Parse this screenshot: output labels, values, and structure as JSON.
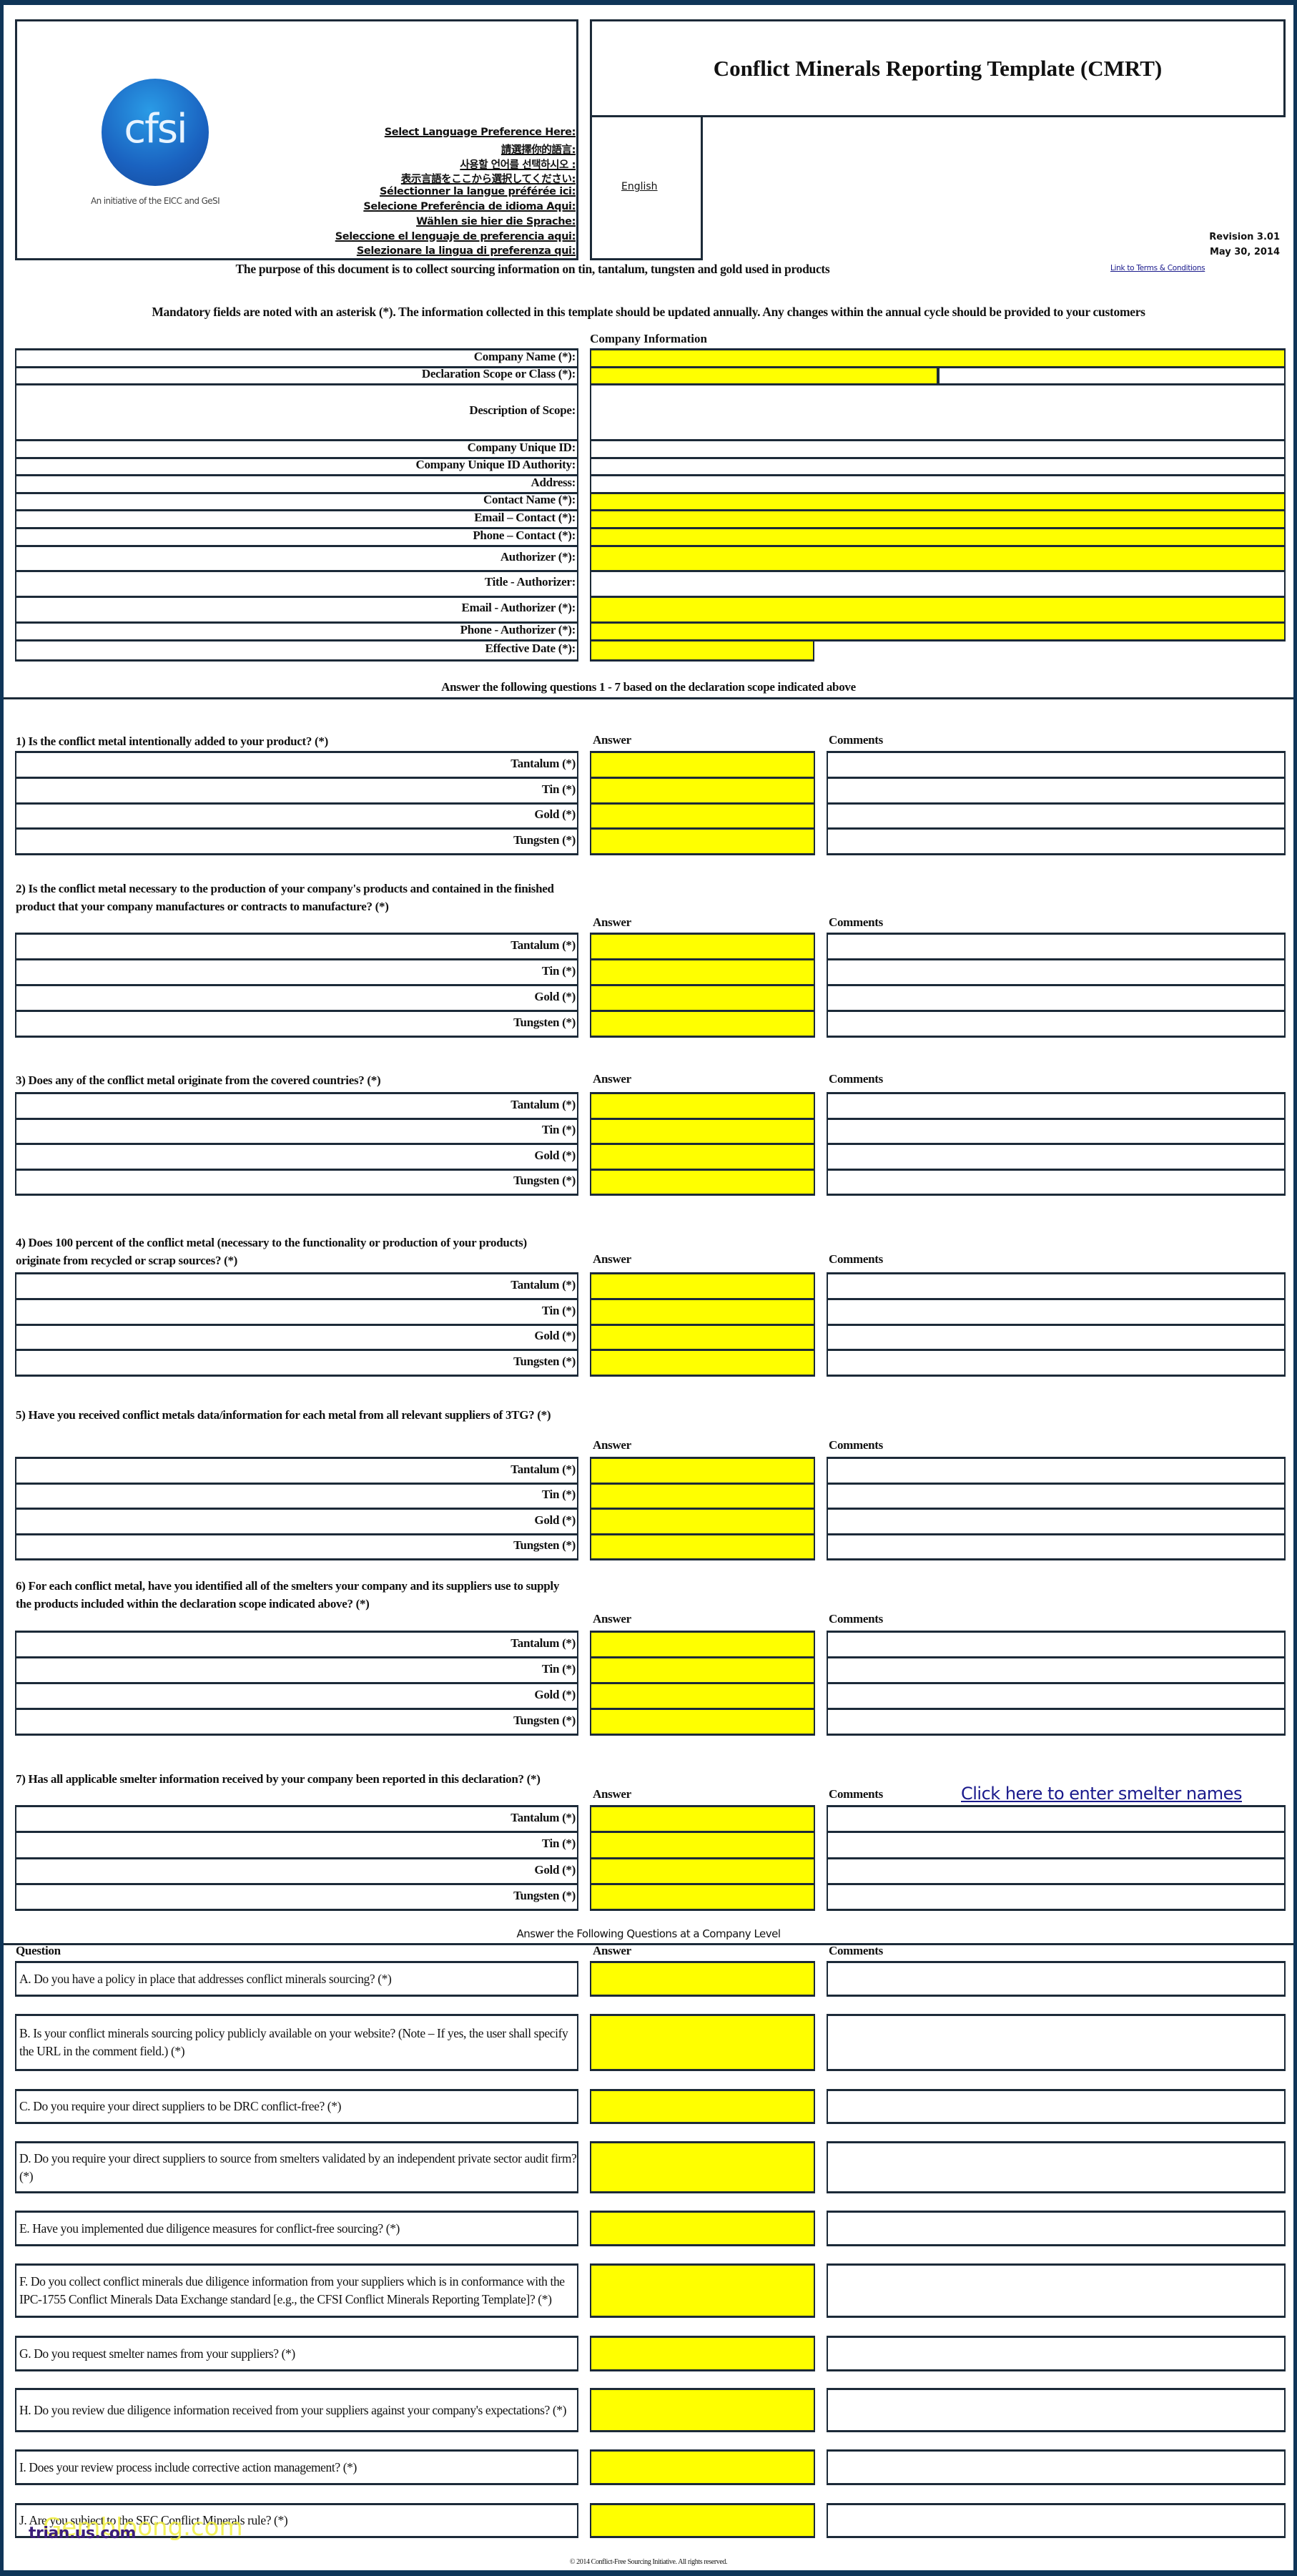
{
  "header": {
    "title": "Conflict Minerals Reporting Template (CMRT)",
    "logo_text": "cfsi",
    "logo_tagline": "An initiative of the EICC and GeSI",
    "language_prompts": [
      "Select Language Preference Here:",
      "請選擇你的語言:",
      "사용할 언어를 선택하시오 :",
      "表示言語をここから選択してください:",
      "Sélectionner la langue préférée ici:",
      "Selecione Preferência de idioma Aqui:",
      "Wählen sie hier die Sprache:",
      "Seleccione el lenguaje de preferencia aqui:",
      "Selezionare la lingua di preferenza qui:"
    ],
    "language_selected": "English",
    "revision": "Revision 3.01",
    "date": "May 30, 2014",
    "terms_link": "Link to Terms & Conditions"
  },
  "intro": {
    "purpose": "The purpose of this document is to collect sourcing information on tin, tantalum, tungsten and gold used in products",
    "mandatory": "Mandatory fields are noted with an asterisk (*). The information collected in this template should be updated annually. Any changes within the annual cycle should be provided to your customers"
  },
  "company_info": {
    "heading": "Company Information",
    "fields": [
      {
        "label": "Company Name (*):",
        "value": "",
        "required": true
      },
      {
        "label": "Declaration Scope or Class (*):",
        "value": "",
        "required": true
      },
      {
        "label": "Description of Scope:",
        "value": "",
        "required": false
      },
      {
        "label": "Company Unique ID:",
        "value": "",
        "required": false
      },
      {
        "label": "Company Unique ID Authority:",
        "value": "",
        "required": false
      },
      {
        "label": "Address:",
        "value": "",
        "required": false
      },
      {
        "label": "Contact Name (*):",
        "value": "",
        "required": true
      },
      {
        "label": "Email – Contact (*):",
        "value": "",
        "required": true
      },
      {
        "label": "Phone – Contact (*):",
        "value": "",
        "required": true
      },
      {
        "label": "Authorizer (*):",
        "value": "",
        "required": true
      },
      {
        "label": "Title - Authorizer:",
        "value": "",
        "required": false
      },
      {
        "label": "Email - Authorizer (*):",
        "value": "",
        "required": true
      },
      {
        "label": "Phone - Authorizer (*):",
        "value": "",
        "required": true
      },
      {
        "label": "Effective Date (*):",
        "value": "",
        "required": true
      }
    ]
  },
  "metal_questions": {
    "heading": "Answer the following questions 1 - 7 based on the declaration scope indicated above",
    "answer_header": "Answer",
    "comments_header": "Comments",
    "metals": [
      "Tantalum (*)",
      "Tin (*)",
      "Gold (*)",
      "Tungsten (*)"
    ],
    "smelter_link": "Click here to enter smelter names",
    "questions": [
      "1) Is the conflict metal intentionally added to your product? (*)",
      "2) Is the conflict metal necessary to the production of your company's products and contained in the finished product that your company manufactures or contracts to manufacture? (*)",
      "3) Does any of the conflict metal originate from the covered countries? (*)",
      "4) Does 100 percent of the conflict metal (necessary to the functionality or production of your products) originate from recycled or scrap sources? (*)",
      "5) Have you received conflict metals data/information for each metal from all relevant suppliers of 3TG? (*)",
      "6) For each conflict metal, have you identified all of the smelters your company and its suppliers use to supply the products included within the declaration scope indicated above? (*)",
      "7) Has all applicable smelter information received by your company been reported in this declaration? (*)"
    ]
  },
  "company_questions": {
    "heading": "Answer the Following Questions at a Company Level",
    "question_header": "Question",
    "answer_header": "Answer",
    "comments_header": "Comments",
    "questions": [
      "A. Do you have a policy in place that addresses conflict minerals sourcing? (*)",
      "B. Is your conflict minerals sourcing policy publicly available on your website? (Note – If yes, the user shall specify the URL in the comment field.) (*)",
      "C. Do you require your direct suppliers to be DRC conflict-free? (*)",
      "D. Do you require your direct suppliers to source from smelters validated by an independent private sector audit firm? (*)",
      "E. Have you implemented due diligence measures for conflict-free sourcing? (*)",
      "F. Do you collect conflict minerals due diligence information from your suppliers which is in conformance with the IPC-1755 Conflict Minerals Data Exchange standard [e.g., the CFSI Conflict Minerals Reporting Template]? (*)",
      "G. Do you request smelter names from your suppliers? (*)",
      "H. Do you review due diligence information received from your suppliers against your company's expectations? (*)",
      "I. Does your review process include corrective action management? (*)",
      "J. Are you subject to the SEC Conflict Minerals rule? (*)"
    ]
  },
  "footer": {
    "copyright": "© 2014 Conflict-Free Sourcing Initiative. All rights reserved."
  },
  "watermark": [
    "Gembloong.com",
    "trian.us.com"
  ],
  "colors": {
    "frame": "#0f3558",
    "required_field": "#ffff00",
    "logo_blue": "#1f6fc8",
    "link": "#1a1a8c"
  }
}
